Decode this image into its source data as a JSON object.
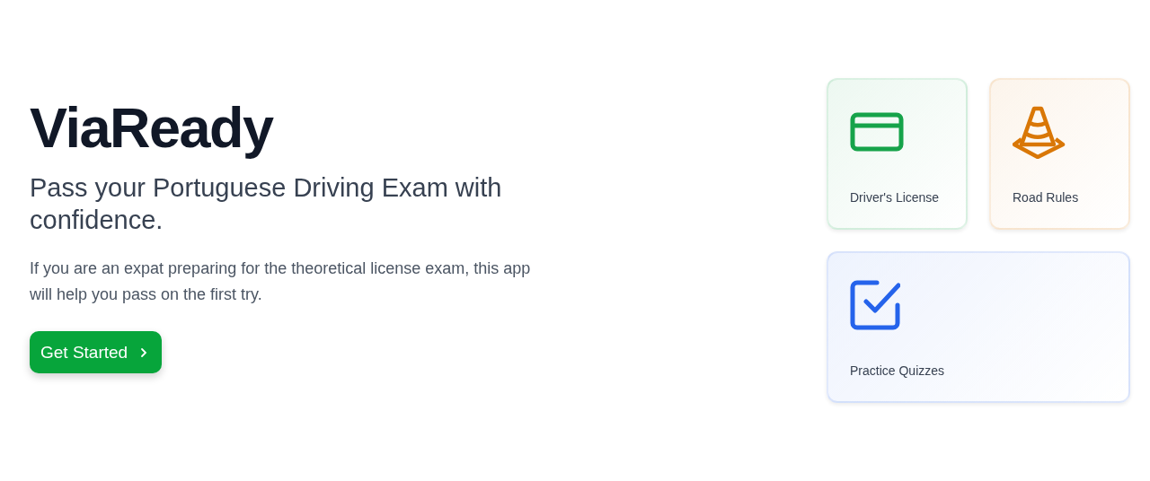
{
  "hero": {
    "title": "ViaReady",
    "subtitle": "Pass your Portuguese Driving Exam with confidence.",
    "description": "If you are an expat preparing for the theoretical license exam, this app will help you pass on the first try.",
    "button": "Get Started"
  },
  "cards": [
    {
      "label": "Driver's License",
      "kind": "card",
      "color": "#16a34a"
    },
    {
      "label": "Road Rules",
      "kind": "cone",
      "color": "#d97706"
    },
    {
      "label": "Practice Quizzes",
      "kind": "check",
      "color": "#2563eb"
    }
  ]
}
